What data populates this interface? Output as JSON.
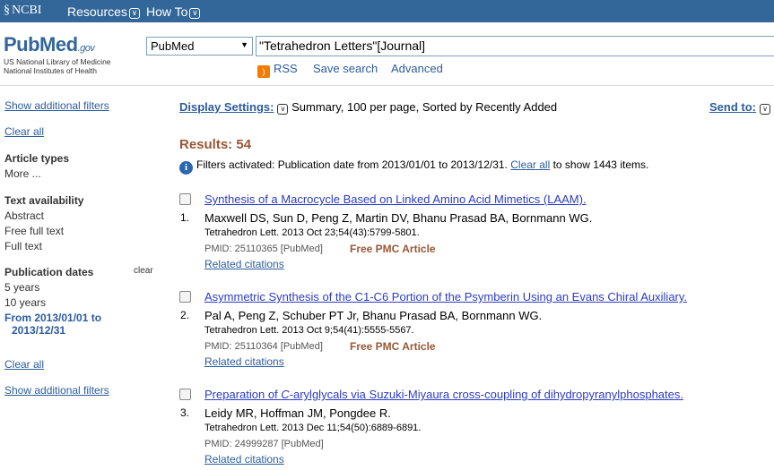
{
  "ncbi": {
    "logo": "NCBI",
    "resources": "Resources",
    "howto": "How To"
  },
  "header": {
    "logo_main": "PubMed",
    "logo_gov": ".gov",
    "nlm_line1": "US National Library of Medicine",
    "nlm_line2": "National Institutes of Health",
    "db_selected": "PubMed",
    "search_value": "\"Tetrahedron Letters\"[Journal]",
    "rss": "RSS",
    "save_search": "Save search",
    "advanced": "Advanced"
  },
  "sidebar": {
    "show_filters_top": "Show additional filters",
    "clear_all_top": "Clear all",
    "article_types": "Article types",
    "more": "More ...",
    "text_availability": "Text availability",
    "abstract": "Abstract",
    "free_full_text": "Free full text",
    "full_text": "Full text",
    "publication_dates": "Publication dates",
    "clear": "clear",
    "five_years": "5 years",
    "ten_years": "10 years",
    "date_range_l1": "From 2013/01/01 to",
    "date_range_l2": "2013/12/31",
    "clear_all_bottom": "Clear all",
    "show_filters_bottom": "Show additional filters"
  },
  "main": {
    "display_settings": "Display Settings:",
    "display_summary": "Summary, 100 per page, Sorted by Recently Added",
    "send_to": "Send to:",
    "results": "Results: 54",
    "filters_pre": "Filters activated: Publication date from 2013/01/01 to 2013/12/31.",
    "filters_link": "Clear all",
    "filters_post": "to show 1443 items."
  },
  "results": [
    {
      "num": "1.",
      "title": "Synthesis of a Macrocycle Based on Linked Amino Acid Mimetics (LAAM).",
      "authors": "Maxwell DS, Sun D, Peng Z, Martin DV, Bhanu Prasad BA, Bornmann WG.",
      "journal": "Tetrahedron Lett. 2013 Oct 23;54(43):5799-5801.",
      "pmid": "PMID: 25110365 [PubMed]",
      "pmc": "Free PMC Article",
      "related": "Related citations"
    },
    {
      "num": "2.",
      "title": "Asymmetric Synthesis of the C1-C6 Portion of the Psymberin Using an Evans Chiral Auxiliary.",
      "authors": "Pal A, Peng Z, Schuber PT Jr, Bhanu Prasad BA, Bornmann WG.",
      "journal": "Tetrahedron Lett. 2013 Oct 9;54(41):5555-5567.",
      "pmid": "PMID: 25110364 [PubMed]",
      "pmc": "Free PMC Article",
      "related": "Related citations"
    },
    {
      "num": "3.",
      "title_pre": "Preparation of ",
      "title_italic": "C",
      "title_post": "-arylglycals via Suzuki-Miyaura cross-coupling of dihydropyranylphosphates.",
      "authors": "Leidy MR, Hoffman JM, Pongdee R.",
      "journal": "Tetrahedron Lett. 2013 Dec 11;54(50):6889-6891.",
      "pmid": "PMID: 24999287 [PubMed]",
      "related": "Related citations"
    }
  ]
}
